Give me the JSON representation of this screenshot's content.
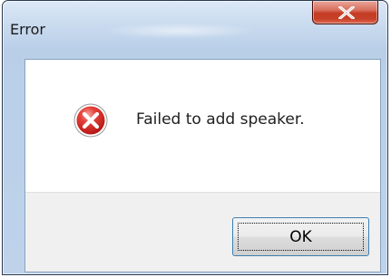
{
  "window": {
    "title": "Error",
    "close_icon": "close-icon",
    "close_color": "#c7412a"
  },
  "dialog": {
    "icon": "error-icon",
    "icon_color": "#d2322d",
    "message": "Failed to add speaker."
  },
  "buttons": {
    "ok_label": "OK"
  }
}
